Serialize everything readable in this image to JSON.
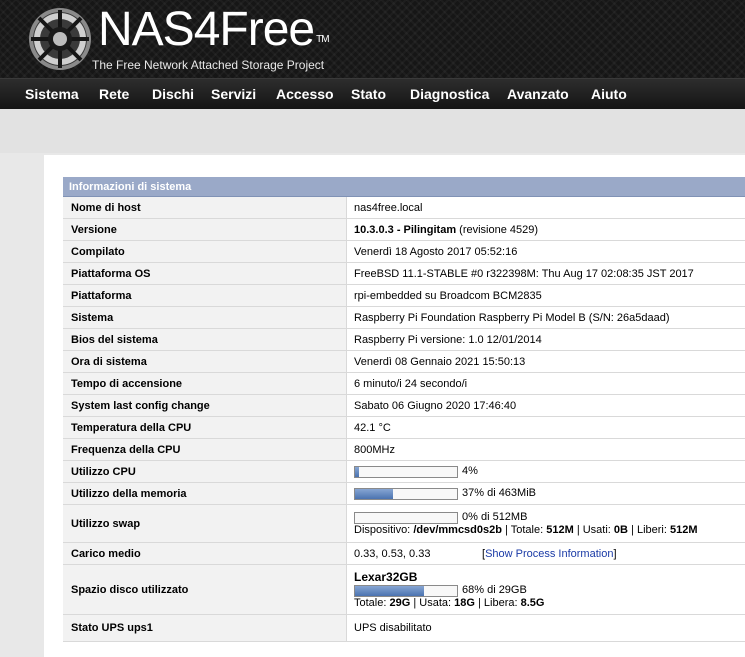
{
  "header": {
    "logo_word": "NAS4Free",
    "logo_tm": "TM",
    "tagline": "The Free Network Attached Storage Project"
  },
  "nav": [
    "Sistema",
    "Rete",
    "Dischi",
    "Servizi",
    "Accesso",
    "Stato",
    "Diagnostica",
    "Avanzato",
    "Aiuto"
  ],
  "table": {
    "header": "Informazioni di sistema",
    "rows": {
      "hostname": {
        "label": "Nome di host",
        "value": "nas4free.local"
      },
      "version": {
        "label": "Versione",
        "value_bold": "10.3.0.3 - Pilingitam",
        "value_rest": "(revisione 4529)"
      },
      "built": {
        "label": "Compilato",
        "value": "Venerdì 18 Agosto 2017 05:52:16"
      },
      "os": {
        "label": "Piattaforma OS",
        "value": "FreeBSD 11.1-STABLE #0 r322398M: Thu Aug 17 02:08:35 JST 2017"
      },
      "platform": {
        "label": "Piattaforma",
        "value": "rpi-embedded su Broadcom BCM2835"
      },
      "system": {
        "label": "Sistema",
        "value": "Raspberry Pi Foundation Raspberry Pi Model B (S/N: 26a5daad)"
      },
      "bios": {
        "label": "Bios del sistema",
        "value": "Raspberry Pi versione: 1.0 12/01/2014"
      },
      "time": {
        "label": "Ora di sistema",
        "value": "Venerdì 08 Gennaio 2021 15:50:13"
      },
      "uptime": {
        "label": "Tempo di accensione",
        "value": "6 minuto/i 24 secondo/i"
      },
      "config": {
        "label": "System last config change",
        "value": "Sabato 06 Giugno 2020 17:46:40"
      },
      "temp": {
        "label": "Temperatura della CPU",
        "value": "42.1  °C"
      },
      "freq": {
        "label": "Frequenza della CPU",
        "value": "800MHz"
      },
      "cpu": {
        "label": "Utilizzo CPU",
        "percent": 4,
        "text": "4%"
      },
      "mem": {
        "label": "Utilizzo della memoria",
        "percent": 37,
        "text": "37% di 463MiB"
      },
      "swap": {
        "label": "Utilizzo swap",
        "percent": 0,
        "text": "0% di 512MB",
        "dev_label": "Dispositivo:",
        "dev": "/dev/mmcsd0s2b",
        "tot_label": "| Totale:",
        "tot": "512M",
        "used_label": "| Usati:",
        "used": "0B",
        "free_label": "| Liberi:",
        "free": "512M"
      },
      "load": {
        "label": "Carico medio",
        "value": "0.33, 0.53, 0.33",
        "link_open": "[",
        "link": "Show Process Information",
        "link_close": "]"
      },
      "disk": {
        "label": "Spazio disco utilizzato",
        "name": "Lexar32GB",
        "percent": 68,
        "text": "68% di 29GB",
        "tot_label": "Totale:",
        "tot": "29G",
        "used_label": "| Usata:",
        "used": "18G",
        "free_label": "| Libera:",
        "free": "8.5G"
      },
      "ups": {
        "label": "Stato UPS ups1",
        "value": "UPS disabilitato"
      }
    }
  },
  "colors": {
    "header_bg": "#161616",
    "table_header": "#9aa9c8",
    "bar_fill": "#4b73b0",
    "link": "#1a3aa6"
  }
}
